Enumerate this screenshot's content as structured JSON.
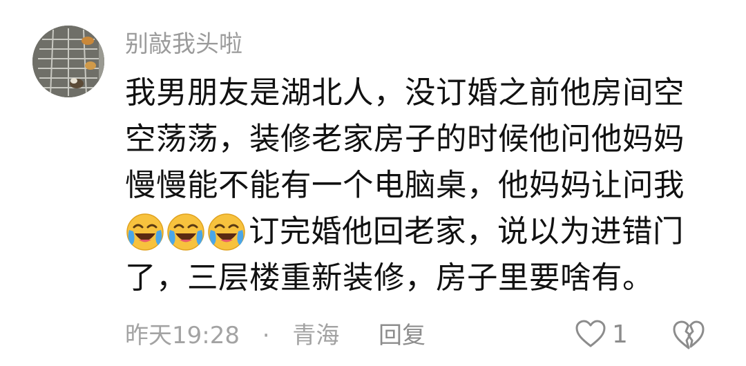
{
  "comment": {
    "username": "别敲我头啦",
    "avatar_icon": "avatar-photo-icon",
    "text_lines": [
      "我男朋友是湖北人，没订婚之前他房间空",
      "空荡荡，装修老家房子的时候他问他妈妈",
      "慢慢能不能有一个电脑桌，他妈妈让问我",
      "订完婚他回老家，说以为进错门",
      "了，三层楼重新装修，房子里要啥有。"
    ],
    "emojis": [
      "laugh-cry-emoji-icon",
      "laugh-cry-emoji-icon",
      "laugh-cry-emoji-icon"
    ],
    "time": "昨天19:28",
    "separator": "·",
    "location": "青海",
    "reply_label": "回复",
    "like_icon": "heart-outline-icon",
    "like_count": "1",
    "dislike_icon": "broken-heart-icon"
  },
  "colors": {
    "username": "#9b9b9b",
    "text": "#111111",
    "meta": "#a3a3a3",
    "action": "#8c8c8c",
    "emoji_face": "#f7c23e",
    "emoji_tear": "#4aa6e8"
  }
}
